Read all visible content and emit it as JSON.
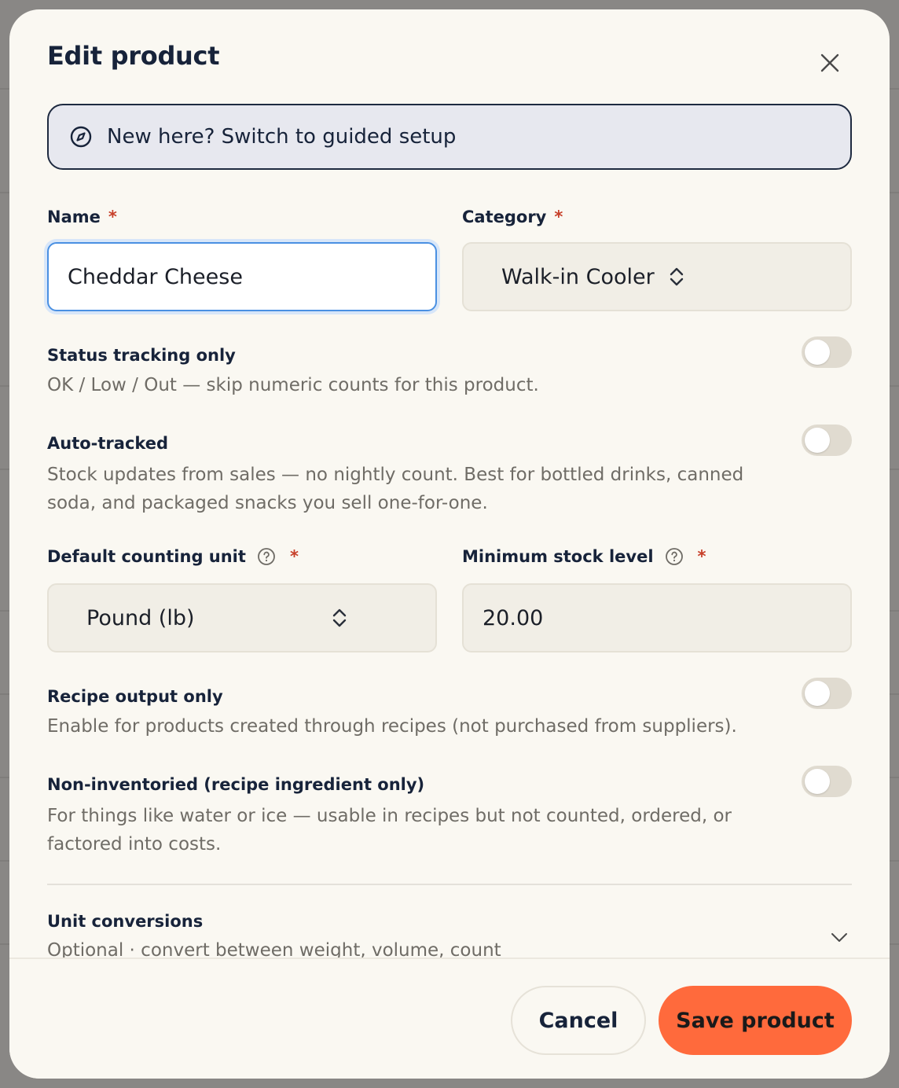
{
  "dialog": {
    "title": "Edit product",
    "close_icon": "close-icon"
  },
  "banner": {
    "icon": "compass-icon",
    "text": "New here? Switch to guided setup"
  },
  "fields": {
    "name": {
      "label": "Name",
      "required_mark": "*",
      "value": "Cheddar Cheese"
    },
    "category": {
      "label": "Category",
      "required_mark": "*",
      "value": "Walk-in Cooler"
    },
    "counting_unit": {
      "label": "Default counting unit",
      "required_mark": "*",
      "value": "Pound (lb)"
    },
    "min_stock": {
      "label": "Minimum stock level",
      "required_mark": "*",
      "value": "20.00"
    }
  },
  "toggles": [
    {
      "title": "Status tracking only",
      "description": "OK / Low / Out — skip numeric counts for this product.",
      "on": false
    },
    {
      "title": "Auto-tracked",
      "description": "Stock updates from sales — no nightly count. Best for bottled drinks, canned soda, and packaged snacks you sell one-for-one.",
      "on": false
    },
    {
      "title": "Recipe output only",
      "description": "Enable for products created through recipes (not purchased from suppliers).",
      "on": false
    },
    {
      "title": "Non-inventoried (recipe ingredient only)",
      "description": "For things like water or ice — usable in recipes but not counted, ordered, or factored into costs.",
      "on": false
    }
  ],
  "conversions": {
    "title": "Unit conversions",
    "subtitle": "Optional · convert between weight, volume, count"
  },
  "footer": {
    "cancel_label": "Cancel",
    "save_label": "Save product"
  },
  "colors": {
    "accent": "#ff6a3c",
    "focus_border": "#4a90e2",
    "required": "#c7402a",
    "modal_bg": "#faf8f2"
  }
}
